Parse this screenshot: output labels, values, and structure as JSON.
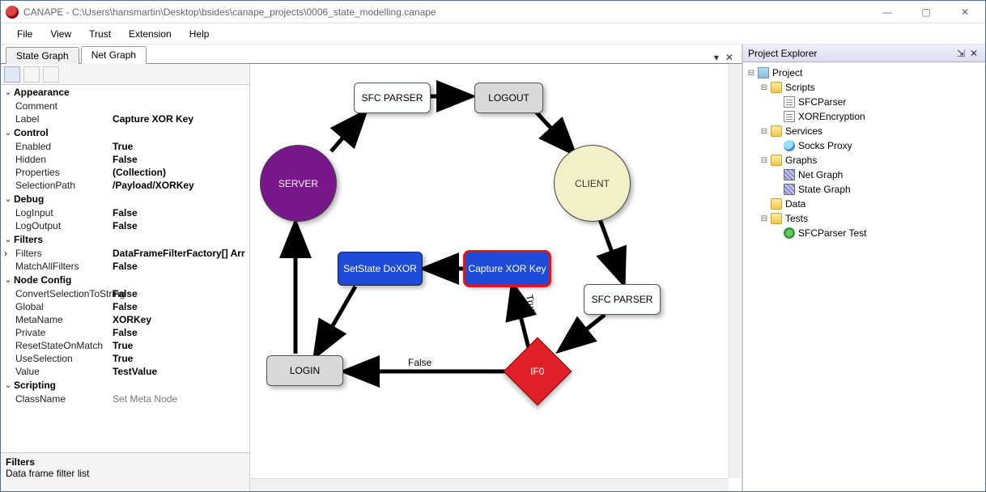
{
  "title": "CANAPE - C:\\Users\\hansmartin\\Desktop\\bsides\\canape_projects\\0006_state_modelling.canape",
  "menus": [
    "File",
    "View",
    "Trust",
    "Extension",
    "Help"
  ],
  "tabs": {
    "items": [
      "State Graph",
      "Net Graph"
    ],
    "active": 1
  },
  "properties": {
    "categories": [
      {
        "name": "Appearance",
        "items": [
          {
            "k": "Comment",
            "v": ""
          },
          {
            "k": "Label",
            "v": "Capture XOR Key"
          }
        ]
      },
      {
        "name": "Control",
        "items": [
          {
            "k": "Enabled",
            "v": "True"
          },
          {
            "k": "Hidden",
            "v": "False"
          },
          {
            "k": "Properties",
            "v": "(Collection)"
          },
          {
            "k": "SelectionPath",
            "v": "/Payload/XORKey"
          }
        ]
      },
      {
        "name": "Debug",
        "items": [
          {
            "k": "LogInput",
            "v": "False"
          },
          {
            "k": "LogOutput",
            "v": "False"
          }
        ]
      },
      {
        "name": "Filters",
        "items": [
          {
            "k": "Filters",
            "v": "DataFrameFilterFactory[] Arr",
            "expand": true
          },
          {
            "k": "MatchAllFilters",
            "v": "False"
          }
        ]
      },
      {
        "name": "Node Config",
        "items": [
          {
            "k": "ConvertSelectionToString",
            "v": "False"
          },
          {
            "k": "Global",
            "v": "False"
          },
          {
            "k": "MetaName",
            "v": "XORKey"
          },
          {
            "k": "Private",
            "v": "False"
          },
          {
            "k": "ResetStateOnMatch",
            "v": "True"
          },
          {
            "k": "UseSelection",
            "v": "True"
          },
          {
            "k": "Value",
            "v": "TestValue"
          }
        ]
      },
      {
        "name": "Scripting",
        "items": [
          {
            "k": "ClassName",
            "v": "Set Meta Node",
            "light": true
          }
        ]
      }
    ],
    "desc": {
      "title": "Filters",
      "body": "Data frame filter list"
    }
  },
  "graph": {
    "nodes": {
      "server": {
        "label": "SERVER"
      },
      "sfc1": {
        "label": "SFC PARSER"
      },
      "logout": {
        "label": "LOGOUT"
      },
      "client": {
        "label": "CLIENT"
      },
      "setstate": {
        "label": "SetState DoXOR"
      },
      "capture": {
        "label": "Capture XOR Key"
      },
      "sfc2": {
        "label": "SFC PARSER"
      },
      "login": {
        "label": "LOGIN"
      },
      "if0": {
        "label": "IF0"
      }
    },
    "edge_labels": {
      "true": "True",
      "false": "False"
    }
  },
  "explorer": {
    "title": "Project Explorer",
    "root": "Project",
    "folders": {
      "scripts": {
        "label": "Scripts",
        "items": [
          "SFCParser",
          "XOREncryption"
        ]
      },
      "services": {
        "label": "Services",
        "items": [
          "Socks Proxy"
        ]
      },
      "graphs": {
        "label": "Graphs",
        "items": [
          "Net Graph",
          "State Graph"
        ]
      },
      "data": {
        "label": "Data"
      },
      "tests": {
        "label": "Tests",
        "items": [
          "SFCParser Test"
        ]
      }
    }
  }
}
